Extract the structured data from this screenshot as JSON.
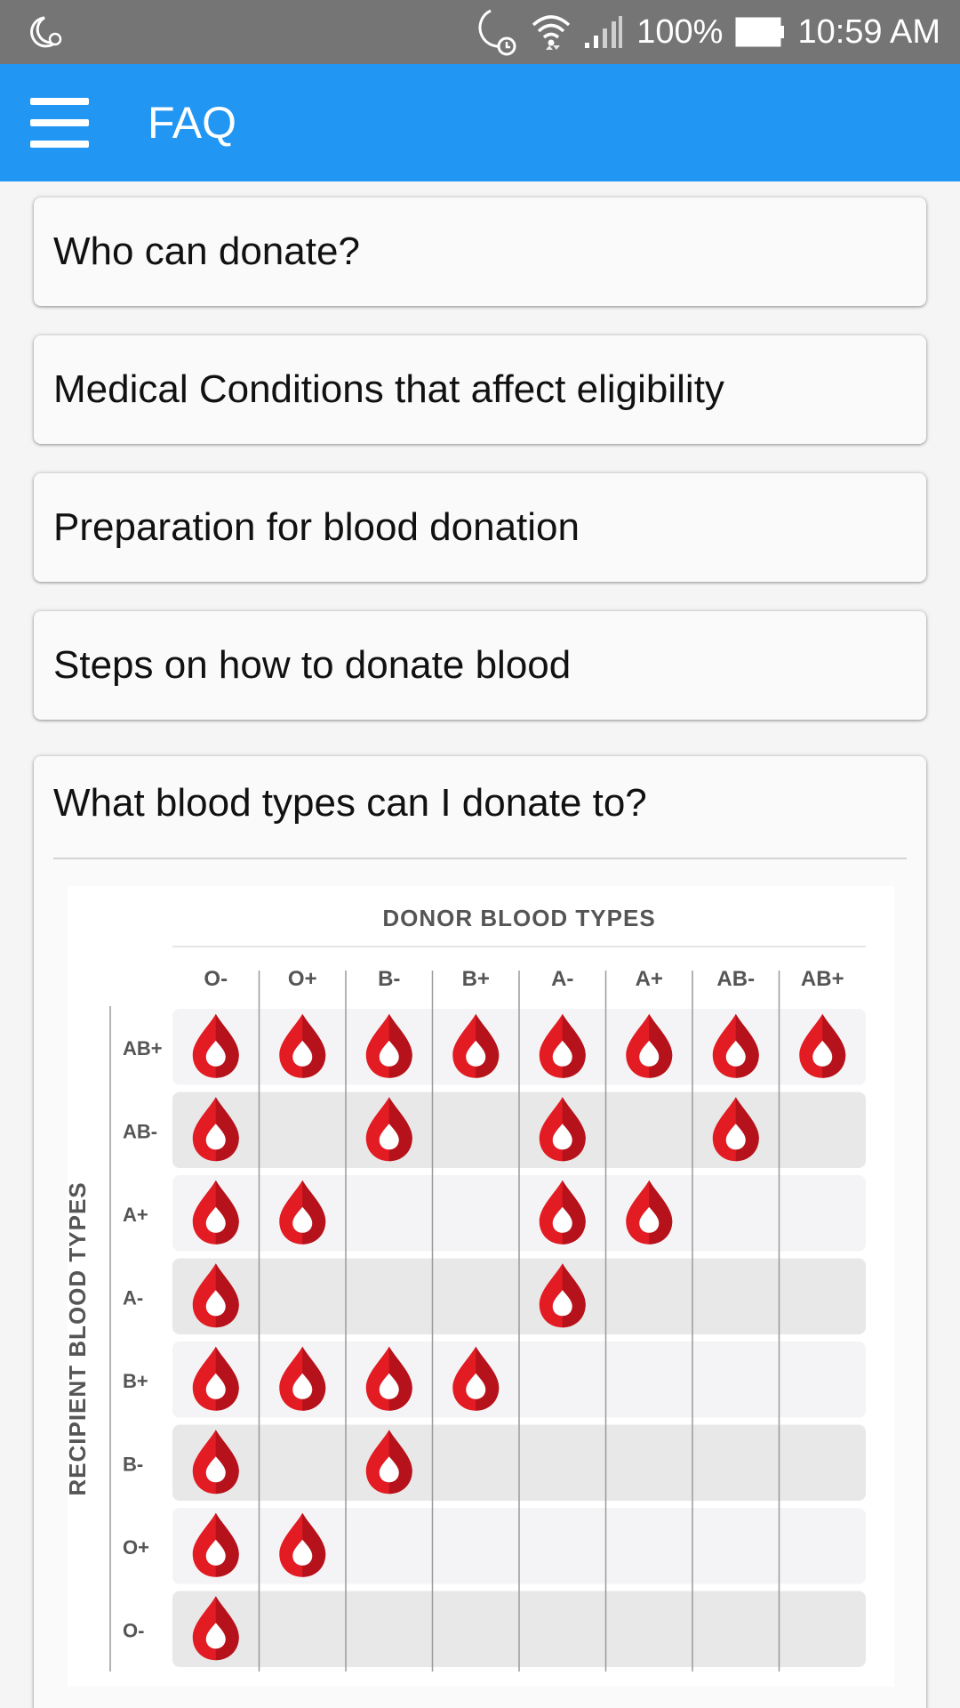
{
  "status_bar": {
    "battery": "100%",
    "time": "10:59 AM"
  },
  "app_bar": {
    "title": "FAQ"
  },
  "faq": {
    "items": [
      {
        "question": "Who can donate?"
      },
      {
        "question": "Medical Conditions that affect eligibility"
      },
      {
        "question": "Preparation for blood donation"
      },
      {
        "question": "Steps on how to donate blood"
      },
      {
        "question": "What blood types can I donate to?"
      }
    ]
  },
  "chart_data": {
    "type": "table",
    "title": "DONOR BLOOD TYPES",
    "row_axis_label": "RECIPIENT BLOOD TYPES",
    "donor_types": [
      "O-",
      "O+",
      "B-",
      "B+",
      "A-",
      "A+",
      "AB-",
      "AB+"
    ],
    "recipient_types": [
      "AB+",
      "AB-",
      "A+",
      "A-",
      "B+",
      "B-",
      "O+",
      "O-"
    ],
    "compatibility": [
      [
        1,
        1,
        1,
        1,
        1,
        1,
        1,
        1
      ],
      [
        1,
        0,
        1,
        0,
        1,
        0,
        1,
        0
      ],
      [
        1,
        1,
        0,
        0,
        1,
        1,
        0,
        0
      ],
      [
        1,
        0,
        0,
        0,
        1,
        0,
        0,
        0
      ],
      [
        1,
        1,
        1,
        1,
        0,
        0,
        0,
        0
      ],
      [
        1,
        0,
        1,
        0,
        0,
        0,
        0,
        0
      ],
      [
        1,
        1,
        0,
        0,
        0,
        0,
        0,
        0
      ],
      [
        1,
        0,
        0,
        0,
        0,
        0,
        0,
        0
      ]
    ],
    "colors": {
      "drop": "#e31b23",
      "drop_shade": "#b5121b",
      "row_light": "#f4f4f6",
      "row_dark": "#e8e8e8"
    }
  }
}
